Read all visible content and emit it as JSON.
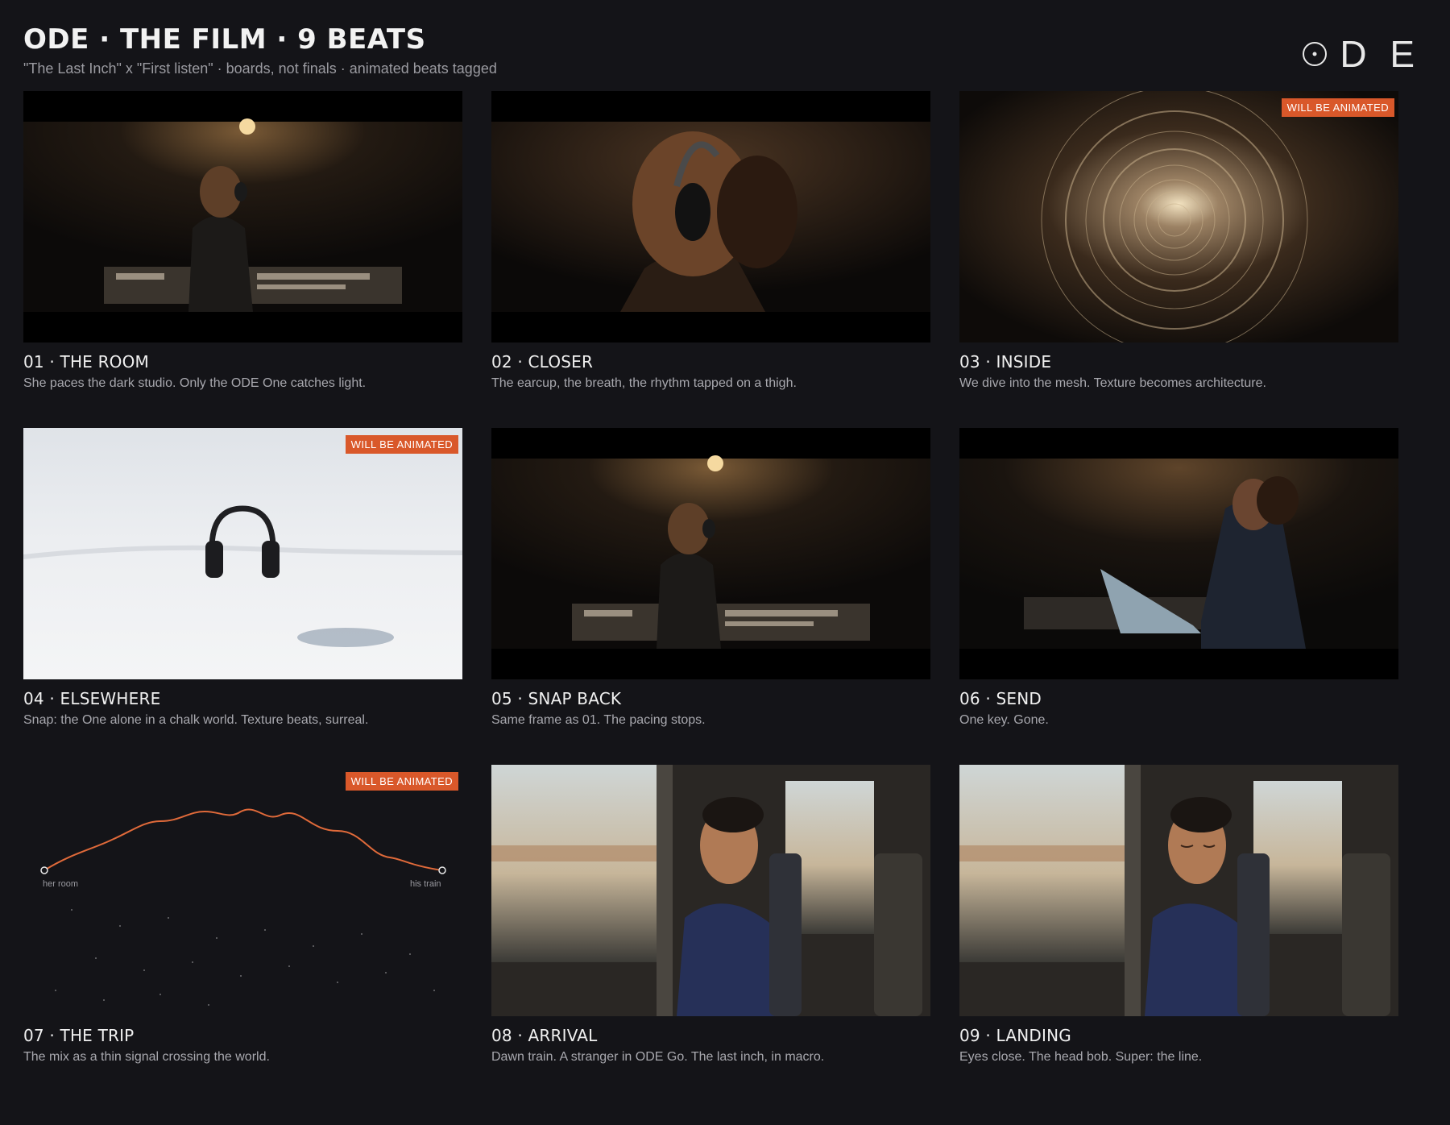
{
  "header": {
    "title": "ODE · THE FILM · 9 BEATS",
    "subtitle": "\"The Last Inch\" x \"First listen\" · boards, not finals · animated beats tagged"
  },
  "logo": {
    "letters": "D E",
    "icon": "ode-o-dot-icon"
  },
  "colors": {
    "background": "#141418",
    "badge": "#D9582A",
    "signal": "#E06A3A"
  },
  "beats": [
    {
      "title": "01 · THE ROOM",
      "desc": "She paces the dark studio. Only the ODE One catches light.",
      "animated": false,
      "scene": "studio-woman-console"
    },
    {
      "title": "02 · CLOSER",
      "desc": "The earcup, the breath, the rhythm tapped on a thigh.",
      "animated": false,
      "scene": "closeup-headphones"
    },
    {
      "title": "03 · INSIDE",
      "desc": "We dive into the mesh. Texture becomes architecture.",
      "animated": true,
      "scene": "mesh-tunnel"
    },
    {
      "title": "04 · ELSEWHERE",
      "desc": "Snap: the One alone in a chalk world. Texture beats, surreal.",
      "animated": true,
      "scene": "headphones-white-desert"
    },
    {
      "title": "05 · SNAP BACK",
      "desc": "Same frame as 01. The pacing stops.",
      "animated": false,
      "scene": "studio-woman-console"
    },
    {
      "title": "06 · SEND",
      "desc": "One key. Gone.",
      "animated": false,
      "scene": "woman-laptop"
    },
    {
      "title": "07 · THE TRIP",
      "desc": "The mix as a thin signal crossing the world.",
      "animated": true,
      "scene": "signal-line",
      "start_label": "her room",
      "end_label": "his train"
    },
    {
      "title": "08 · ARRIVAL",
      "desc": "Dawn train. A stranger in ODE Go. The last inch, in macro.",
      "animated": false,
      "scene": "man-on-train"
    },
    {
      "title": "09 · LANDING",
      "desc": "Eyes close. The head bob. Super: the line.",
      "animated": false,
      "scene": "man-on-train-eyes-closed"
    }
  ],
  "badge_label": "WILL BE ANIMATED"
}
